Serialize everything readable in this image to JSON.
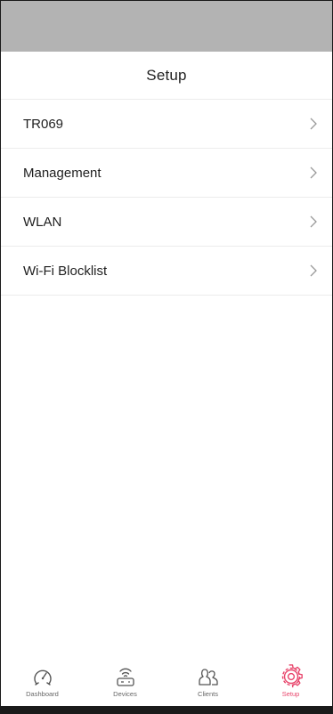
{
  "header": {
    "title": "Setup"
  },
  "menu": {
    "items": [
      {
        "label": "TR069"
      },
      {
        "label": "Management"
      },
      {
        "label": "WLAN"
      },
      {
        "label": "Wi-Fi Blocklist"
      }
    ]
  },
  "tabs": [
    {
      "label": "Dashboard",
      "icon": "dashboard-gauge-icon",
      "active": false
    },
    {
      "label": "Devices",
      "icon": "router-wifi-icon",
      "active": false
    },
    {
      "label": "Clients",
      "icon": "clients-people-icon",
      "active": false
    },
    {
      "label": "Setup",
      "icon": "gear-icon",
      "active": true
    }
  ],
  "colors": {
    "accent": "#e8456b",
    "status_bar": "#b3b3b3",
    "text": "#1f1f1f",
    "divider": "#ececec"
  }
}
